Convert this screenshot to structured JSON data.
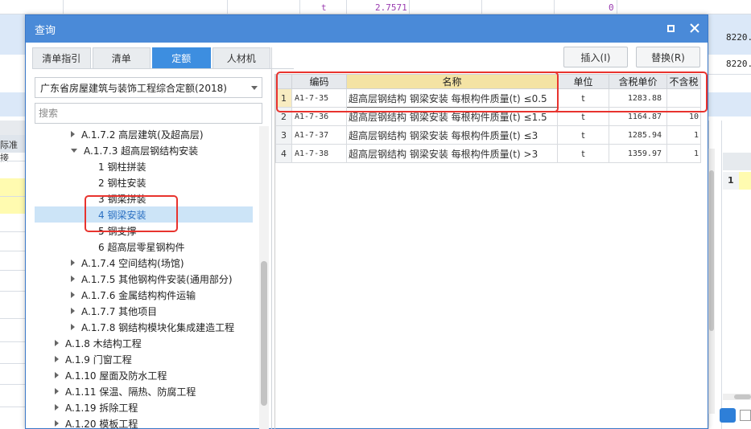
{
  "background": {
    "top_cells": [
      "t",
      "2.7571",
      "0"
    ],
    "side_values": [
      "8220.",
      "8220."
    ],
    "left_label": "际准接",
    "right_row_no": "1"
  },
  "dialog": {
    "title": "查询",
    "tabs": [
      "清单指引",
      "清单",
      "定额",
      "人材机"
    ],
    "active_tab": "定额",
    "quota_library": "广东省房屋建筑与装饰工程综合定额(2018)",
    "search_placeholder": "搜索",
    "insert_label": "插入(I)",
    "replace_label": "替换(R)"
  },
  "tree": [
    {
      "label": "A.1.7.2 高层建筑(及超高层)",
      "level": 2,
      "toggle": "right"
    },
    {
      "label": "A.1.7.3 超高层钢结构安装",
      "level": 2,
      "toggle": "down"
    },
    {
      "label": "1 钢柱拼装",
      "level": 3,
      "toggle": "none"
    },
    {
      "label": "2 钢柱安装",
      "level": 3,
      "toggle": "none"
    },
    {
      "label": "3 钢梁拼装",
      "level": 3,
      "toggle": "none"
    },
    {
      "label": "4 钢梁安装",
      "level": 3,
      "toggle": "none",
      "selected": true
    },
    {
      "label": "5 钢支撑",
      "level": 3,
      "toggle": "none"
    },
    {
      "label": "6 超高层零星钢构件",
      "level": 3,
      "toggle": "none"
    },
    {
      "label": "A.1.7.4 空间结构(场馆)",
      "level": 2,
      "toggle": "right"
    },
    {
      "label": "A.1.7.5 其他钢构件安装(通用部分)",
      "level": 2,
      "toggle": "right"
    },
    {
      "label": "A.1.7.6 金属结构构件运输",
      "level": 2,
      "toggle": "right"
    },
    {
      "label": "A.1.7.7 其他项目",
      "level": 2,
      "toggle": "right"
    },
    {
      "label": "A.1.7.8 钢结构模块化集成建造工程",
      "level": 2,
      "toggle": "right"
    },
    {
      "label": "A.1.8 木结构工程",
      "level": 1,
      "toggle": "right"
    },
    {
      "label": "A.1.9 门窗工程",
      "level": 1,
      "toggle": "right"
    },
    {
      "label": "A.1.10 屋面及防水工程",
      "level": 1,
      "toggle": "right"
    },
    {
      "label": "A.1.11 保温、隔热、防腐工程",
      "level": 1,
      "toggle": "right"
    },
    {
      "label": "A.1.19 拆除工程",
      "level": 1,
      "toggle": "right"
    },
    {
      "label": "A.1.20 模板工程",
      "level": 1,
      "toggle": "right"
    }
  ],
  "table": {
    "headers": [
      "编码",
      "名称",
      "单位",
      "含税单价",
      "不含税"
    ],
    "rows": [
      {
        "no": "1",
        "code": "A1-7-35",
        "name": "超高层钢结构 钢梁安装 每根构件质量(t) ≤0.5",
        "unit": "t",
        "price": "1283.88",
        "price2": ""
      },
      {
        "no": "2",
        "code": "A1-7-36",
        "name": "超高层钢结构 钢梁安装 每根构件质量(t) ≤1.5",
        "unit": "t",
        "price": "1164.87",
        "price2": "10"
      },
      {
        "no": "3",
        "code": "A1-7-37",
        "name": "超高层钢结构 钢梁安装 每根构件质量(t) ≤3",
        "unit": "t",
        "price": "1285.94",
        "price2": "1"
      },
      {
        "no": "4",
        "code": "A1-7-38",
        "name": "超高层钢结构 钢梁安装 每根构件质量(t) >3",
        "unit": "t",
        "price": "1359.97",
        "price2": "1"
      }
    ]
  },
  "colors": {
    "titlebar": "#4a8ad8",
    "active_tab": "#3d8ee0",
    "selection": "#cce4f7",
    "highlight_box": "#e8332e"
  }
}
